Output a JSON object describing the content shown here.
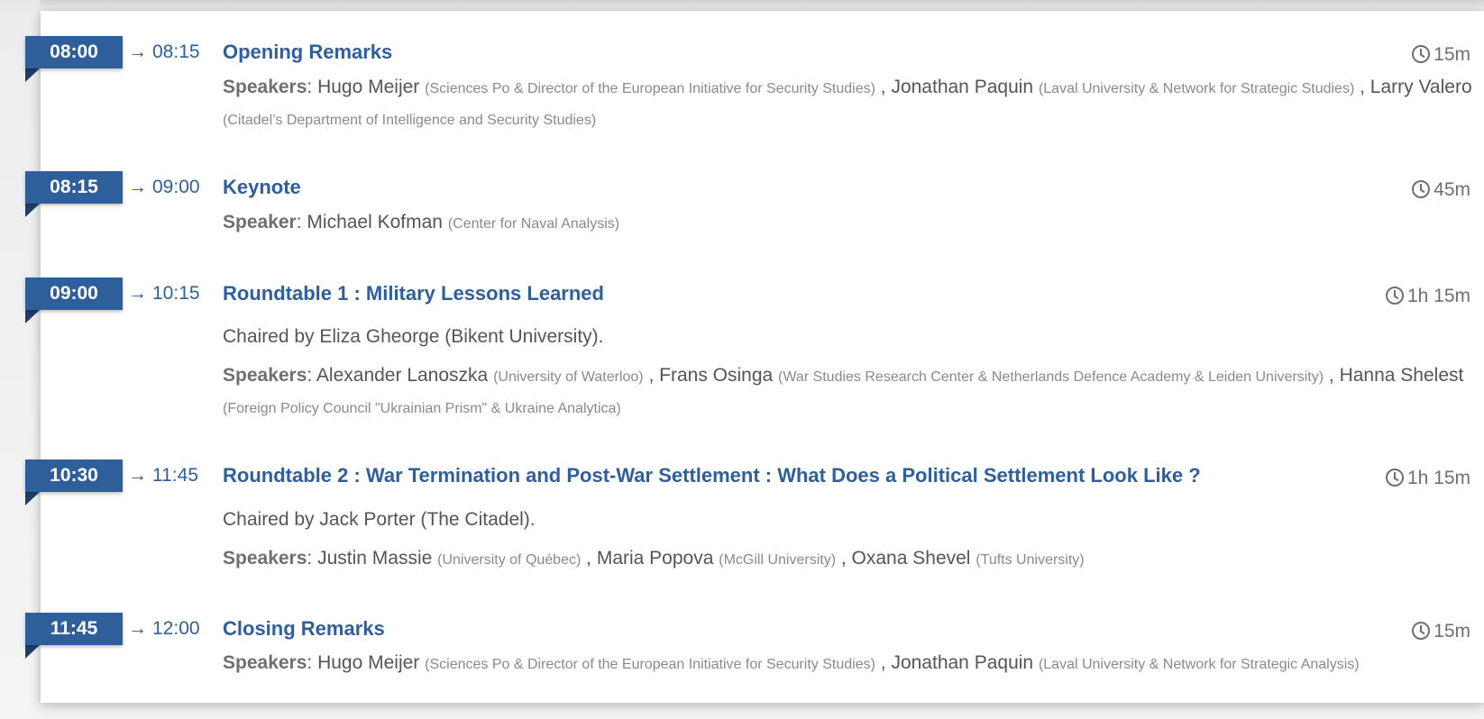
{
  "sessions": [
    {
      "start": "08:00",
      "end": "08:15",
      "title": "Opening Remarks",
      "duration": "15m",
      "speakers_label": "Speakers",
      "speakers": [
        {
          "name": "Hugo Meijer",
          "affiliation": "(Sciences Po & Director of the European Initiative for Security Studies)"
        },
        {
          "name": "Jonathan Paquin",
          "affiliation": "(Laval University & Network for Strategic Studies)"
        },
        {
          "name": "Larry Valero",
          "affiliation": "(Citadel’s Department of Intelligence and Security Studies)"
        }
      ]
    },
    {
      "start": "08:15",
      "end": "09:00",
      "title": "Keynote",
      "duration": "45m",
      "speakers_label": "Speaker",
      "speakers": [
        {
          "name": "Michael Kofman",
          "affiliation": "(Center for Naval Analysis)"
        }
      ]
    },
    {
      "start": "09:00",
      "end": "10:15",
      "title": "Roundtable 1 : Military Lessons Learned",
      "duration": "1h 15m",
      "chair": "Chaired by Eliza Gheorge (Bikent University).",
      "speakers_label": "Speakers",
      "speakers": [
        {
          "name": "Alexander Lanoszka",
          "affiliation": "(University of Waterloo)"
        },
        {
          "name": "Frans Osinga",
          "affiliation": "(War Studies Research Center & Netherlands Defence Academy & Leiden University)"
        },
        {
          "name": "Hanna Shelest",
          "affiliation": "(Foreign Policy Council \"Ukrainian Prism\" & Ukraine Analytica)"
        }
      ]
    },
    {
      "start": "10:30",
      "end": "11:45",
      "title": "Roundtable 2 : War Termination and Post-War Settlement : What Does a Political Settlement Look Like ?",
      "duration": "1h 15m",
      "chair": "Chaired by Jack Porter (The Citadel).",
      "speakers_label": "Speakers",
      "speakers": [
        {
          "name": "Justin Massie",
          "affiliation": "(University of Québec)"
        },
        {
          "name": "Maria Popova",
          "affiliation": "(McGill University)"
        },
        {
          "name": "Oxana Shevel",
          "affiliation": "(Tufts University)"
        }
      ]
    },
    {
      "start": "11:45",
      "end": "12:00",
      "title": "Closing Remarks",
      "duration": "15m",
      "speakers_label": "Speakers",
      "speakers": [
        {
          "name": "Hugo Meijer",
          "affiliation": "(Sciences Po & Director of the European Initiative for Security Studies)"
        },
        {
          "name": "Jonathan Paquin",
          "affiliation": "(Laval University & Network for Strategic Analysis)"
        }
      ]
    }
  ]
}
